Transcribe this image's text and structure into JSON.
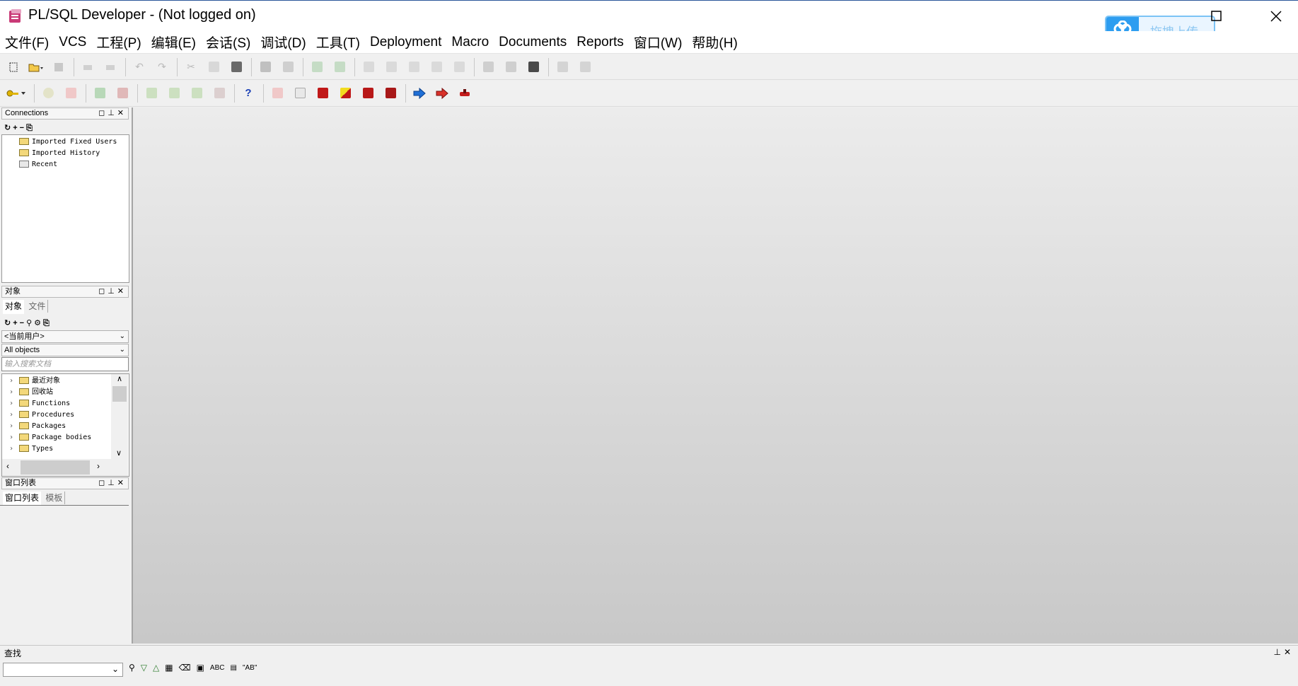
{
  "window": {
    "title": "PL/SQL Developer - (Not logged on)",
    "upload_label": "拖拽上传"
  },
  "menu": [
    "文件(F)",
    "VCS",
    "工程(P)",
    "编辑(E)",
    "会话(S)",
    "调试(D)",
    "工具(T)",
    "Deployment",
    "Macro",
    "Documents",
    "Reports",
    "窗口(W)",
    "帮助(H)"
  ],
  "connections_panel": {
    "title": "Connections",
    "items": [
      "Imported Fixed Users",
      "Imported History",
      "Recent"
    ]
  },
  "objects_panel": {
    "title": "对象",
    "tabs": [
      "对象",
      "文件"
    ],
    "user_select": "<当前用户>",
    "filter_select": "All objects",
    "search_placeholder": "输入搜索文档",
    "tree": [
      "最近对象",
      "回收站",
      "Functions",
      "Procedures",
      "Packages",
      "Package bodies",
      "Types"
    ]
  },
  "windowlist_panel": {
    "title": "窗口列表",
    "tabs": [
      "窗口列表",
      "模板"
    ]
  },
  "find": {
    "title": "查找",
    "abc_label": "ABC",
    "ab_label": "\"AB\""
  },
  "colors": {
    "accent_blue": "#2d9df0",
    "arrow_blue": "#1f6fd6",
    "arrow_red": "#d9322a"
  }
}
